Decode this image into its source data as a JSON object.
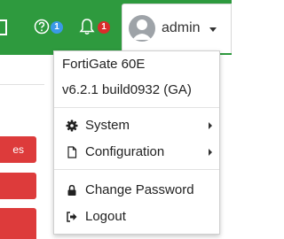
{
  "header": {
    "help_badge": "1",
    "notifications_badge": "1",
    "username": "admin"
  },
  "left_panel": {
    "tab_fragment": "es"
  },
  "dropdown": {
    "model": "FortiGate 60E",
    "version": "v6.2.1 build0932 (GA)",
    "items": [
      {
        "label": "System",
        "icon": "gear-icon",
        "has_submenu": true
      },
      {
        "label": "Configuration",
        "icon": "document-icon",
        "has_submenu": true
      },
      {
        "label": "Change Password",
        "icon": "lock-icon",
        "has_submenu": false
      },
      {
        "label": "Logout",
        "icon": "logout-icon",
        "has_submenu": false
      }
    ]
  },
  "colors": {
    "header_green": "#2e9a3e",
    "help_badge_blue": "#3a99e6",
    "alert_red": "#d92b2b",
    "tab_red": "#dd3b3b"
  }
}
